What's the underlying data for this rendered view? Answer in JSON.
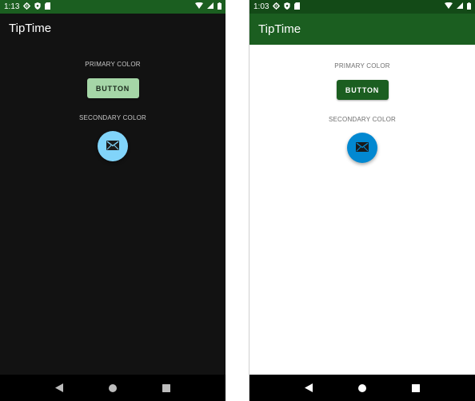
{
  "screens": [
    {
      "theme": "dark",
      "status_bar": {
        "time": "1:13"
      },
      "app_bar": {
        "title": "TipTime"
      },
      "primary_label": "PRIMARY COLOR",
      "button_label": "BUTTON",
      "secondary_label": "SECONDARY COLOR",
      "fab_icon": "mail-icon",
      "colors": {
        "status_bar": "#1b5e20",
        "background": "#121212",
        "button": "#a5d6a7",
        "fab": "#81d4fa"
      }
    },
    {
      "theme": "light",
      "status_bar": {
        "time": "1:03"
      },
      "app_bar": {
        "title": "TipTime"
      },
      "primary_label": "PRIMARY COLOR",
      "button_label": "BUTTON",
      "secondary_label": "SECONDARY COLOR",
      "fab_icon": "mail-icon",
      "colors": {
        "status_bar": "#134a17",
        "app_bar": "#1b5e20",
        "background": "#ffffff",
        "button": "#1b5e20",
        "fab": "#0288d1"
      }
    }
  ],
  "status_icons": [
    "gear-icon",
    "shield-icon",
    "sd-card-icon",
    "wifi-icon",
    "signal-icon",
    "battery-icon"
  ],
  "nav_icons": [
    "back-icon",
    "home-icon",
    "recents-icon"
  ]
}
